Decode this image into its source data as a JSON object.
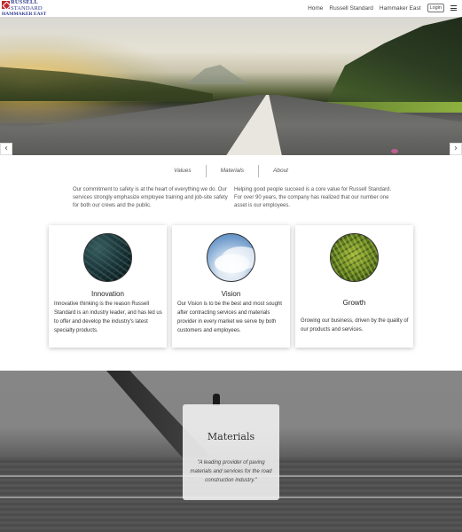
{
  "brand": {
    "line1": "RUSSELL",
    "line2": "STANDARD",
    "line3": "HAMMAKER EAST"
  },
  "nav": {
    "items": [
      "Home",
      "Russell Standard",
      "Hammaker East"
    ],
    "login_label": "Login",
    "menu_icon": "hamburger-icon"
  },
  "hero": {
    "prev_label": "‹",
    "next_label": "›"
  },
  "tabs": [
    "Values",
    "Materials",
    "About"
  ],
  "intro": {
    "left": "Our commitment to safety is at the heart of everything we do. Our services strongly emphasize employee training and job-site safety for both our crews and the public.",
    "right": "Helping good people succeed is a core value for Russell Standard. For over 90 years, the company has realized that our number one asset is our employees."
  },
  "cards": [
    {
      "title": "Innovation",
      "body": "Innovative thinking is the reason Russell Standard is an industry leader, and has led us to offer and develop the industry's latest specialty products."
    },
    {
      "title": "Vision",
      "body": "Our Vision is to be the best and most sought after contracting services and materials provider in every market we serve by both customers and employees."
    },
    {
      "title": "Growth",
      "body": "Growing our business, driven by the quality of our products and services."
    }
  ],
  "materials": {
    "title": "Materials",
    "quote": "\"A leading provider of paving materials and services for the road construction industry.\""
  },
  "colors": {
    "brand_blue": "#2b3a8c",
    "brand_red": "#c0272d"
  }
}
